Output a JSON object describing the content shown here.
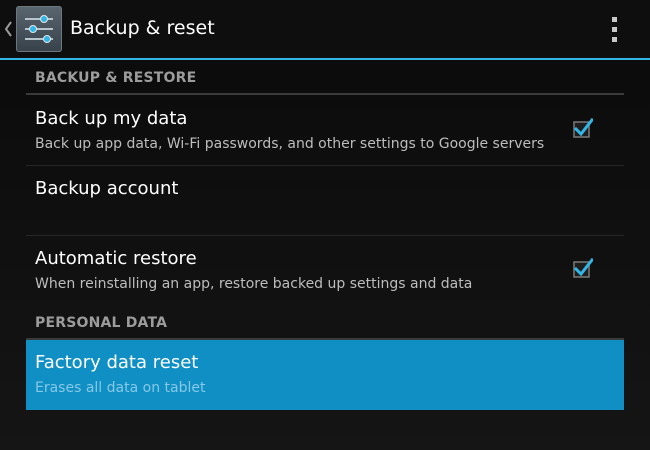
{
  "header": {
    "title": "Backup & reset"
  },
  "sections": [
    {
      "label": "BACKUP & RESTORE",
      "items": [
        {
          "title": "Back up my data",
          "summary": "Back up app data, Wi-Fi passwords, and other settings to Google servers",
          "checked": true
        },
        {
          "title": "Backup account",
          "summary": ""
        },
        {
          "title": "Automatic restore",
          "summary": "When reinstalling an app, restore backed up settings and data",
          "checked": true
        }
      ]
    },
    {
      "label": "PERSONAL DATA",
      "items": [
        {
          "title": "Factory data reset",
          "summary": "Erases all data on tablet",
          "selected": true
        }
      ]
    }
  ],
  "colors": {
    "accent": "#33b5e5",
    "selected_background": "#0f8fc4",
    "background": "#0a0a0a"
  },
  "icons": {
    "up": "chevron-left-icon",
    "app": "settings-sliders-icon",
    "overflow": "overflow-menu-icon",
    "check": "checkbox-checked-icon"
  }
}
